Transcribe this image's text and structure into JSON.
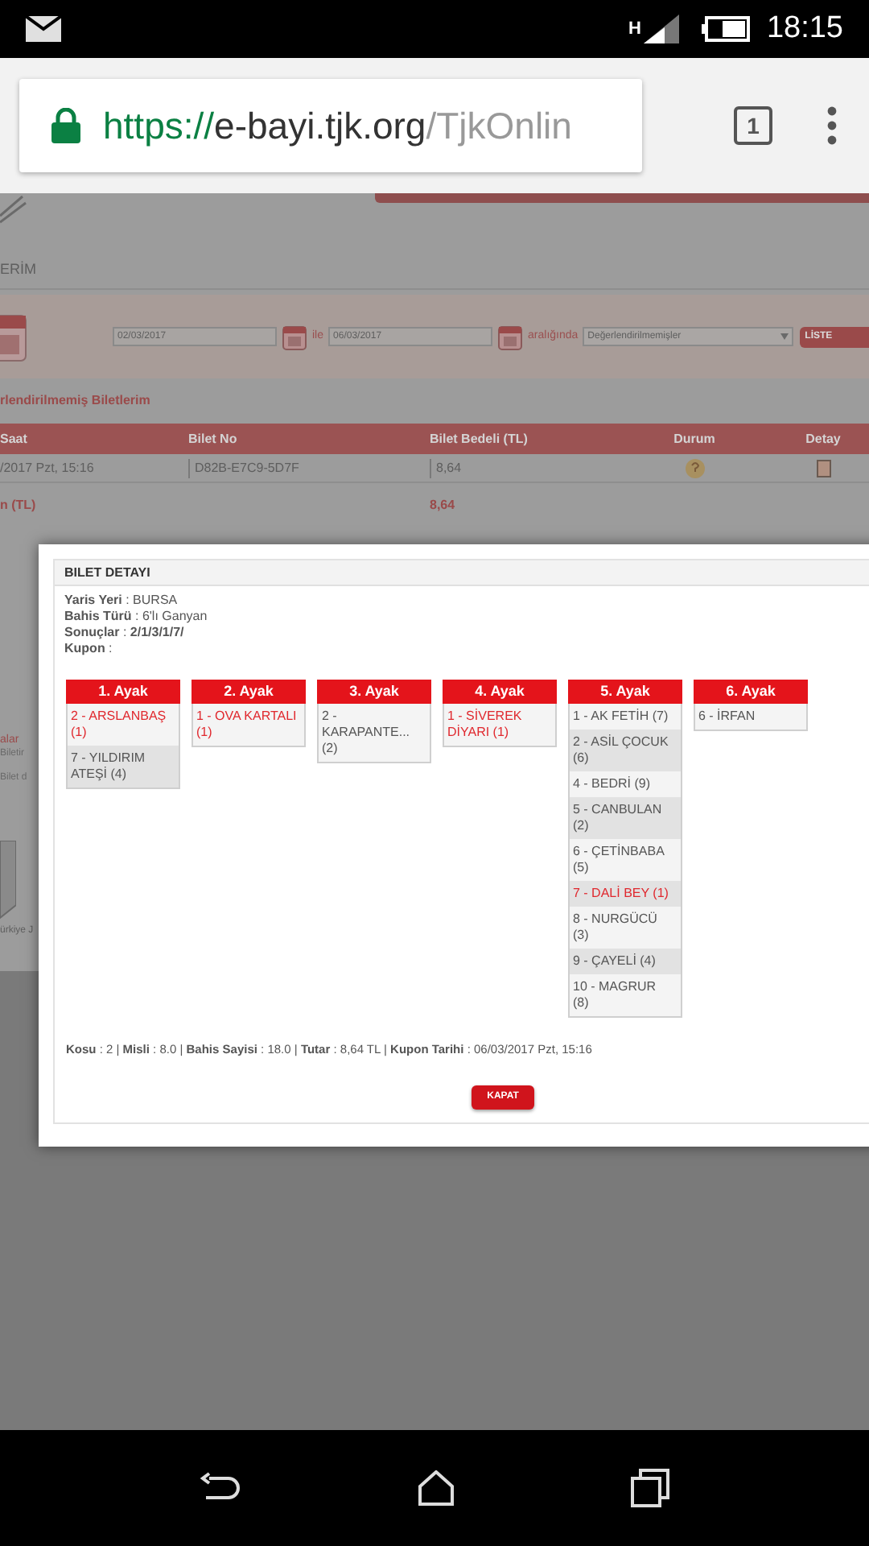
{
  "status_bar": {
    "network": "H",
    "time": "18:15"
  },
  "browser": {
    "url_scheme": "https://",
    "url_host": "e-bayi.tjk.org",
    "url_path": "/TjkOnlin",
    "tab_count": "1"
  },
  "background_page": {
    "section_title": "ERİM",
    "date_from": "02/03/2017",
    "connector": "ile",
    "date_to": "06/03/2017",
    "range_label": "aralığında",
    "filter": "Değerlendirilmemişler",
    "list_button": "LİSTE",
    "table_title": "rlendirilmemiş Biletlerim",
    "columns": [
      "Saat",
      "Bilet No",
      "Bilet Bedeli (TL)",
      "Durum",
      "Detay"
    ],
    "row": [
      "/2017 Pzt, 15:16",
      "D82B-E7C9-5D7F",
      "8,64"
    ],
    "total_label": "n (TL)",
    "total": "8,64",
    "side_title": "alar",
    "side_links": [
      "Biletir",
      "Bilet d"
    ],
    "footer_text": "ürkiye J"
  },
  "dialog": {
    "title": "BILET DETAYI",
    "info": [
      "**Yaris Yeri** : BURSA",
      "**Bahis Türü** : 6'lı Ganyan",
      "**Sonuçlar** : **2/1/3/1/7/**",
      "**Kupon** :"
    ],
    "legs": [
      {
        "title": "1. Ayak",
        "horses": [
          {
            "name": "2 - ARSLANBAŞ (1)",
            "winner": true
          },
          {
            "name": "7 - YILDIRIM ATEŞİ (4)",
            "winner": false
          }
        ]
      },
      {
        "title": "2. Ayak",
        "horses": [
          {
            "name": "1 - OVA KARTALI (1)",
            "winner": true
          }
        ]
      },
      {
        "title": "3. Ayak",
        "horses": [
          {
            "name": "2 - KARAPANTE... (2)",
            "winner": false
          }
        ]
      },
      {
        "title": "4. Ayak",
        "horses": [
          {
            "name": "1 - SİVEREK DİYARI (1)",
            "winner": true
          }
        ]
      },
      {
        "title": "5. Ayak",
        "horses": [
          {
            "name": "1 - AK FETİH (7)",
            "winner": false
          },
          {
            "name": "2 - ASİL ÇOCUK (6)",
            "winner": false
          },
          {
            "name": "4 - BEDRİ (9)",
            "winner": false
          },
          {
            "name": "5 - CANBULAN (2)",
            "winner": false
          },
          {
            "name": "6 - ÇETİNBABA (5)",
            "winner": false
          },
          {
            "name": "7 - DALİ BEY (1)",
            "winner": true
          },
          {
            "name": "8 - NURGÜCÜ (3)",
            "winner": false
          },
          {
            "name": "9 - ÇAYELİ (4)",
            "winner": false
          },
          {
            "name": "10 - MAGRUR (8)",
            "winner": false
          }
        ]
      },
      {
        "title": "6. Ayak",
        "horses": [
          {
            "name": "6 - İRFAN",
            "winner": false
          }
        ]
      }
    ],
    "summary": "**Kosu** : 2 | **Misli** : 8.0 | **Bahis Sayisi** : 18.0 |  **Tutar** : 8,64 TL  | **Kupon Tarihi** : 06/03/2017 Pzt, 15:16",
    "close_button": "KAPAT"
  }
}
